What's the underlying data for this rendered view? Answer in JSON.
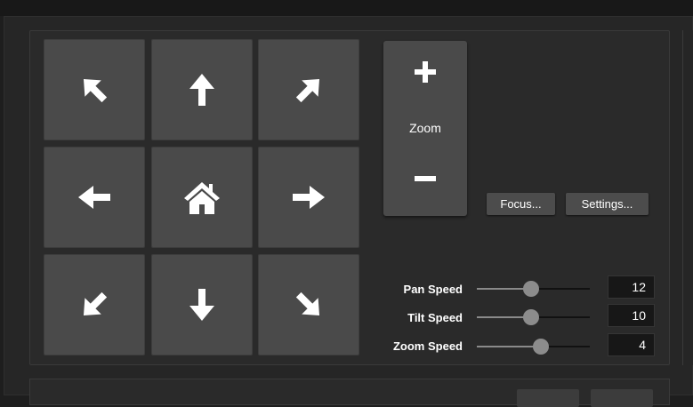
{
  "ptz": {
    "buttons": [
      {
        "icon": "arrow-up-left-icon"
      },
      {
        "icon": "arrow-up-icon"
      },
      {
        "icon": "arrow-up-right-icon"
      },
      {
        "icon": "arrow-left-icon"
      },
      {
        "icon": "home-icon"
      },
      {
        "icon": "arrow-right-icon"
      },
      {
        "icon": "arrow-down-left-icon"
      },
      {
        "icon": "arrow-down-icon"
      },
      {
        "icon": "arrow-down-right-icon"
      }
    ]
  },
  "zoom": {
    "label": "Zoom",
    "plus_icon": "plus-icon",
    "minus_icon": "minus-icon"
  },
  "buttons": {
    "focus_label": "Focus...",
    "settings_label": "Settings..."
  },
  "speeds": [
    {
      "label": "Pan Speed",
      "value": "12",
      "level": 0.48
    },
    {
      "label": "Tilt Speed",
      "value": "10",
      "level": 0.48
    },
    {
      "label": "Zoom Speed",
      "value": "4",
      "level": 0.57
    }
  ],
  "colors": {
    "background": "#262626",
    "button": "#4a4a4a",
    "icon": "#ffffff",
    "value_box": "#171717"
  }
}
